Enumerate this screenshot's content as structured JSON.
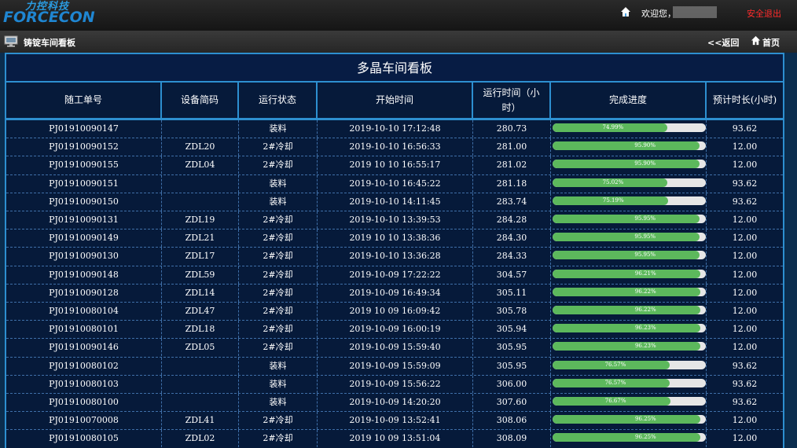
{
  "brand": {
    "cn": "力控科技",
    "en": "FORCECON"
  },
  "header": {
    "welcome": "欢迎您，",
    "logout": "安全退出"
  },
  "subheader": {
    "title": "铸锭车间看板",
    "back": "<<返回",
    "home": "首页"
  },
  "board": {
    "title": "多晶车间看板",
    "columns": [
      "随工单号",
      "设备简码",
      "运行状态",
      "开始时间",
      "运行时间（小时）",
      "完成进度",
      "预计时长(小时)"
    ],
    "rows": [
      {
        "order": "PJ01910090147",
        "device": "",
        "status": "装料",
        "start": "2019-10-10 17:12:48",
        "runtime": "280.73",
        "progress_label": "74.99%",
        "progress": 74.99,
        "estimate": "93.62"
      },
      {
        "order": "PJ01910090152",
        "device": "ZDL20",
        "status": "2#冷却",
        "start": "2019-10-10 16:56:33",
        "runtime": "281.00",
        "progress_label": "95.90%",
        "progress": 95.9,
        "estimate": "12.00"
      },
      {
        "order": "PJ01910090155",
        "device": "ZDL04",
        "status": "2#冷却",
        "start": "2019 10 10 16:55:17",
        "runtime": "281.02",
        "progress_label": "95.90%",
        "progress": 95.9,
        "estimate": "12.00"
      },
      {
        "order": "PJ01910090151",
        "device": "",
        "status": "装料",
        "start": "2019-10-10 16:45:22",
        "runtime": "281.18",
        "progress_label": "75.02%",
        "progress": 75.02,
        "estimate": "93.62"
      },
      {
        "order": "PJ01910090150",
        "device": "",
        "status": "装料",
        "start": "2019-10-10 14:11:45",
        "runtime": "283.74",
        "progress_label": "75.19%",
        "progress": 75.19,
        "estimate": "93.62"
      },
      {
        "order": "PJ01910090131",
        "device": "ZDL19",
        "status": "2#冷却",
        "start": "2019-10-10 13:39:53",
        "runtime": "284.28",
        "progress_label": "95.95%",
        "progress": 95.95,
        "estimate": "12.00"
      },
      {
        "order": "PJ01910090149",
        "device": "ZDL21",
        "status": "2#冷却",
        "start": "2019 10 10 13:38:36",
        "runtime": "284.30",
        "progress_label": "95.95%",
        "progress": 95.95,
        "estimate": "12.00"
      },
      {
        "order": "PJ01910090130",
        "device": "ZDL17",
        "status": "2#冷却",
        "start": "2019-10-10 13:36:28",
        "runtime": "284.33",
        "progress_label": "95.95%",
        "progress": 95.95,
        "estimate": "12.00"
      },
      {
        "order": "PJ01910090148",
        "device": "ZDL59",
        "status": "2#冷却",
        "start": "2019-10-09 17:22:22",
        "runtime": "304.57",
        "progress_label": "96.21%",
        "progress": 96.21,
        "estimate": "12.00"
      },
      {
        "order": "PJ01910090128",
        "device": "ZDL14",
        "status": "2#冷却",
        "start": "2019-10-09 16:49:34",
        "runtime": "305.11",
        "progress_label": "96.22%",
        "progress": 96.22,
        "estimate": "12.00"
      },
      {
        "order": "PJ01910080104",
        "device": "ZDL47",
        "status": "2#冷却",
        "start": "2019 10 09 16:09:42",
        "runtime": "305.78",
        "progress_label": "96.22%",
        "progress": 96.22,
        "estimate": "12.00"
      },
      {
        "order": "PJ01910080101",
        "device": "ZDL18",
        "status": "2#冷却",
        "start": "2019-10-09 16:00:19",
        "runtime": "305.94",
        "progress_label": "96.23%",
        "progress": 96.23,
        "estimate": "12.00"
      },
      {
        "order": "PJ01910090146",
        "device": "ZDL05",
        "status": "2#冷却",
        "start": "2019-10-09 15:59:40",
        "runtime": "305.95",
        "progress_label": "96.23%",
        "progress": 96.23,
        "estimate": "12.00"
      },
      {
        "order": "PJ01910080102",
        "device": "",
        "status": "装料",
        "start": "2019-10-09 15:59:09",
        "runtime": "305.95",
        "progress_label": "76.57%",
        "progress": 76.57,
        "estimate": "93.62"
      },
      {
        "order": "PJ01910080103",
        "device": "",
        "status": "装料",
        "start": "2019-10-09 15:56:22",
        "runtime": "306.00",
        "progress_label": "76.57%",
        "progress": 76.57,
        "estimate": "93.62"
      },
      {
        "order": "PJ01910080100",
        "device": "",
        "status": "装料",
        "start": "2019-10-09 14:20:20",
        "runtime": "307.60",
        "progress_label": "76.67%",
        "progress": 76.67,
        "estimate": "93.62"
      },
      {
        "order": "PJ01910070008",
        "device": "ZDL41",
        "status": "2#冷却",
        "start": "2019-10-09 13:52:41",
        "runtime": "308.06",
        "progress_label": "96.25%",
        "progress": 96.25,
        "estimate": "12.00"
      },
      {
        "order": "PJ01910080105",
        "device": "ZDL02",
        "status": "2#冷却",
        "start": "2019 10 09 13:51:04",
        "runtime": "308.09",
        "progress_label": "96.25%",
        "progress": 96.25,
        "estimate": "12.00"
      }
    ]
  },
  "colors": {
    "border": "#2d8fd0",
    "progress": "#5cb85c",
    "logout": "#ff2b2b"
  },
  "icons": {
    "home": "home-icon",
    "monitor": "monitor-icon"
  }
}
